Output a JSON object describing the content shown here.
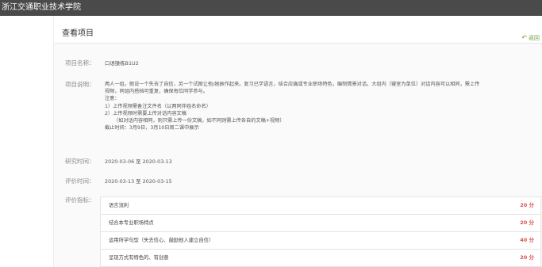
{
  "app": {
    "title": "浙江交通职业技术学院"
  },
  "header": {
    "title": "查看项目",
    "back_label": "返回",
    "back_icon": "undo-arrow-icon",
    "accent": "#6a9f3f"
  },
  "project": {
    "name_label": "项目名称：",
    "name_value": "口语操练B1U2",
    "desc_label": "项目说明：",
    "desc_lines": [
      "两人一组。假设一个失去了自信，另一个试图让他/她振作起来。复习已学语言，结合应痛或专业职场特色，编制情景对话。大组内（寝室为单位）对话内容可以相同，需上传",
      "视频，同组内搭档可重复，确保每位同学参与。",
      "注意：",
      "1）上传视频需备注文件名（以两同伴姓名命名）",
      "2）上传视频时需要上传对话内容文稿",
      "（如对话内容相同，则只需上传一份文稿，如不同则需上传各自的文稿+视频）",
      "截止时间：3月9日，3月10日周二课中展示"
    ],
    "research_label": "研究时间：",
    "research_value": "2020-03-06 至 2020-03-13",
    "eval_label": "评价时间：",
    "eval_value": "2020-03-13 至 2020-03-15",
    "criteria_label": "评价指标：",
    "criteria": [
      {
        "name": "语言流利",
        "score": "20 分"
      },
      {
        "name": "结合本专业职场特点",
        "score": "20 分"
      },
      {
        "name": "运用所学句型（失去信心、鼓励他人建立自信）",
        "score": "40 分"
      },
      {
        "name": "呈现方式有特色的、有创意",
        "score": "20 分"
      }
    ],
    "score_color": "#d9534f"
  }
}
